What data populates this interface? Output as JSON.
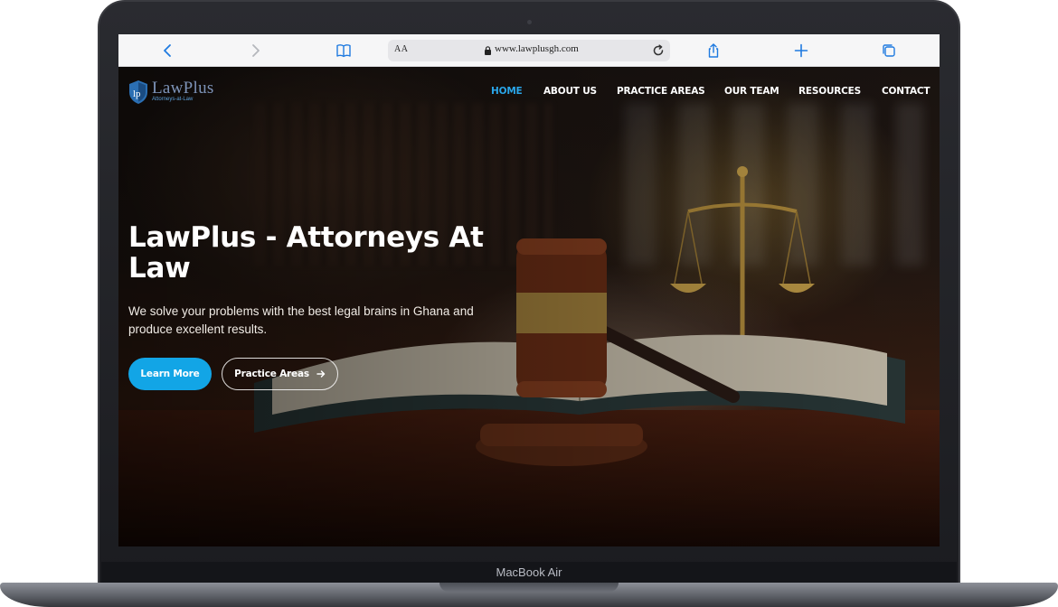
{
  "device": {
    "label": "MacBook Air"
  },
  "browser": {
    "text_size_label": "AA",
    "url": "www.lawplusgh.com",
    "icons": [
      "back-icon",
      "forward-icon",
      "bookmarks-icon",
      "lock-icon",
      "reload-icon",
      "share-icon",
      "new-tab-icon",
      "tabs-icon"
    ]
  },
  "site": {
    "logo": {
      "name": "LawPlus",
      "tagline": "Attorneys-at-Law",
      "mark": "lp"
    },
    "nav": [
      {
        "label": "HOME",
        "active": true
      },
      {
        "label": "ABOUT US",
        "active": false
      },
      {
        "label": "PRACTICE AREAS",
        "active": false
      },
      {
        "label": "OUR TEAM",
        "active": false
      },
      {
        "label": "RESOURCES",
        "active": false
      },
      {
        "label": "CONTACT",
        "active": false
      }
    ],
    "hero": {
      "title": "LawPlus - Attorneys At Law",
      "subtitle": "We solve your problems with the best legal brains in Ghana and produce excellent results.",
      "primary_button": "Learn More",
      "secondary_button": "Practice Areas"
    }
  },
  "colors": {
    "accent": "#12a5e6",
    "nav_active": "#2aa5e8",
    "logo": "#7d93b8"
  }
}
